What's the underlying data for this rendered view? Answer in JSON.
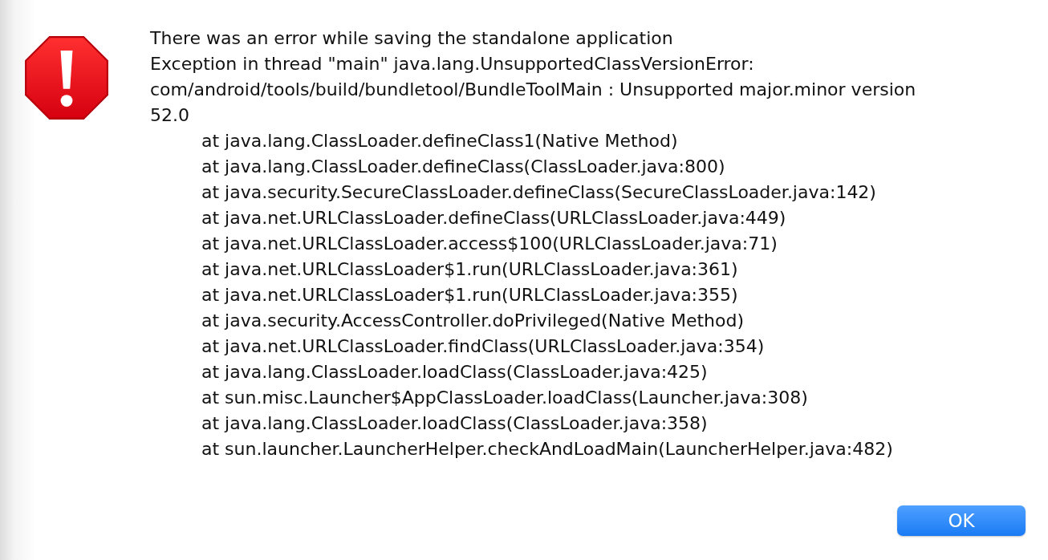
{
  "dialog": {
    "kind": "error",
    "title": "There was an error while saving the standalone application",
    "message": "Exception in thread \"main\" java.lang.UnsupportedClassVersionError: com/android/tools/build/bundletool/BundleToolMain : Unsupported major.minor version 52.0",
    "stack_trace": [
      "at java.lang.ClassLoader.defineClass1(Native Method)",
      "at java.lang.ClassLoader.defineClass(ClassLoader.java:800)",
      "at java.security.SecureClassLoader.defineClass(SecureClassLoader.java:142)",
      "at java.net.URLClassLoader.defineClass(URLClassLoader.java:449)",
      "at java.net.URLClassLoader.access$100(URLClassLoader.java:71)",
      "at java.net.URLClassLoader$1.run(URLClassLoader.java:361)",
      "at java.net.URLClassLoader$1.run(URLClassLoader.java:355)",
      "at java.security.AccessController.doPrivileged(Native Method)",
      "at java.net.URLClassLoader.findClass(URLClassLoader.java:354)",
      "at java.lang.ClassLoader.loadClass(ClassLoader.java:425)",
      "at sun.misc.Launcher$AppClassLoader.loadClass(Launcher.java:308)",
      "at java.lang.ClassLoader.loadClass(ClassLoader.java:358)",
      "at sun.launcher.LauncherHelper.checkAndLoadMain(LauncherHelper.java:482)"
    ],
    "buttons": [
      {
        "label": "OK",
        "default": true
      }
    ]
  }
}
